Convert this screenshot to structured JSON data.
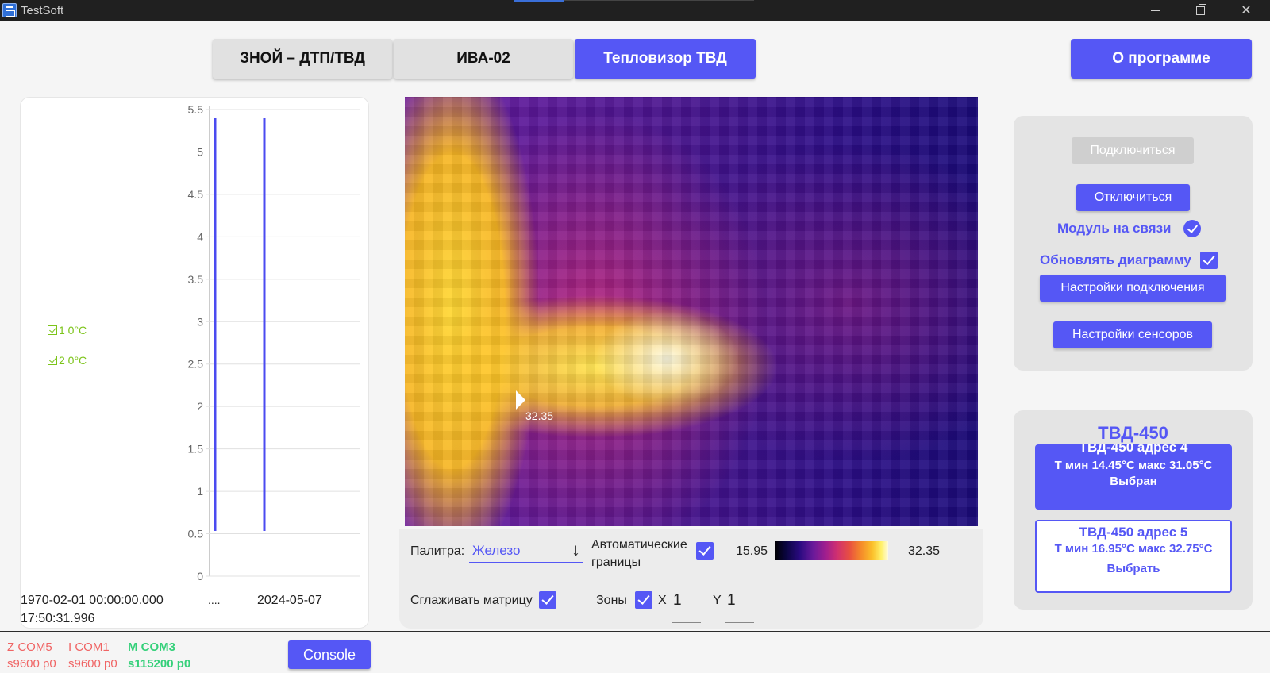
{
  "window": {
    "title": "TestSoft"
  },
  "tabs": [
    {
      "label": "ЗНОЙ – ДТП/ТВД",
      "active": false
    },
    {
      "label": "ИВА-02",
      "active": false
    },
    {
      "label": "Тепловизор ТВД",
      "active": true
    }
  ],
  "about_button": "О программе",
  "chart_data": {
    "type": "line",
    "y_ticks": [
      "5.5",
      "5",
      "4.5",
      "4",
      "3.5",
      "3",
      "2.5",
      "2",
      "1.5",
      "1",
      "0.5",
      "0"
    ],
    "ylim": [
      0,
      5.5
    ],
    "grid": true,
    "legend": [
      {
        "label": "1  0°C",
        "color": "#7cc41a"
      },
      {
        "label": "2  0°C",
        "color": "#7cc41a"
      }
    ],
    "series_color": "#4b4bf0",
    "x_labels": {
      "start": "1970-02-01 00:00:00.000",
      "start_time": "17:50:31.996",
      "ellipsis": "....",
      "end": "2024-05-07"
    }
  },
  "thermal": {
    "hotspot_value": "32.35"
  },
  "controls": {
    "palette_label": "Палитра:",
    "palette_value": "Железо",
    "auto_bounds_line1": "Автоматические",
    "auto_bounds_line2": "границы",
    "min_temp": "15.95",
    "max_temp": "32.35",
    "smooth_label": "Сглаживать матрицу",
    "zones_label": "Зоны",
    "x_label": "X",
    "x_value": "1",
    "y_label": "Y",
    "y_value": "1"
  },
  "connection": {
    "connect": "Подключиться",
    "disconnect": "Отключиться",
    "module_online": "Модуль на связи",
    "update_chart": "Обновлять диаграмму",
    "conn_settings": "Настройки подключения",
    "sensor_settings": "Настройки сенсоров"
  },
  "devices": {
    "title": "ТВД-450",
    "items": [
      {
        "name": "ТВД-450 адрес 4",
        "range": "Т мин 14.45°C макс 31.05°C",
        "action": "Выбран"
      },
      {
        "name": "ТВД-450 адрес 5",
        "range": "Т мин 16.95°C макс 32.75°C",
        "action": "Выбрать"
      }
    ]
  },
  "statusbar": {
    "ports": [
      {
        "name": "Z COM5",
        "speed": "s9600 p0",
        "color": "#f06464"
      },
      {
        "name": "I COM1",
        "speed": "s9600 p0",
        "color": "#f06464"
      },
      {
        "name": "M COM3",
        "speed": "s115200 p0",
        "color": "#35d07a"
      }
    ],
    "console": "Console"
  },
  "colors": {
    "accent": "#5557f5",
    "legend_green": "#7cc41a"
  }
}
